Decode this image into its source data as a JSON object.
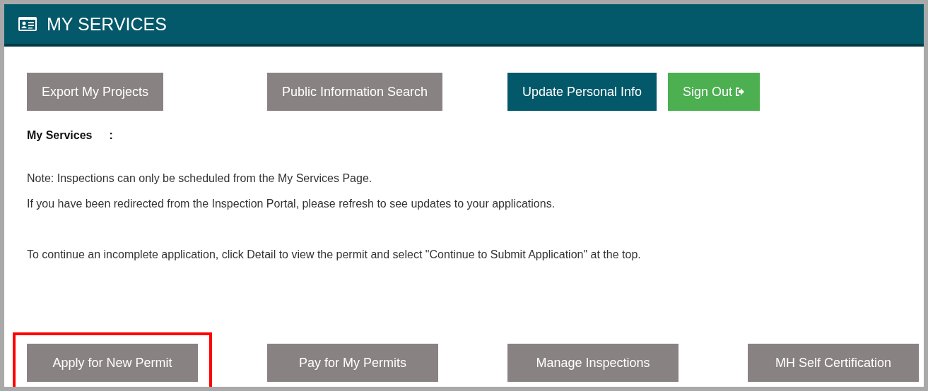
{
  "header": {
    "title": "MY SERVICES"
  },
  "top_buttons": [
    {
      "label": "Export My Projects",
      "kind": "secondary"
    },
    {
      "label": "Public Information Search",
      "kind": "secondary"
    },
    {
      "label": "Update Personal Info",
      "kind": "primary"
    },
    {
      "label": "Sign Out",
      "kind": "success"
    }
  ],
  "section_label": "My Services",
  "section_colon": ":",
  "notes": [
    "Note: Inspections can only be scheduled from the My Services Page.",
    "If you have been redirected from the Inspection Portal, please refresh to see updates to your applications."
  ],
  "instruction": "To continue an incomplete application, click Detail to view the permit and select \"Continue to Submit Application\" at the top.",
  "bottom_buttons": [
    {
      "label": "Apply for New Permit",
      "highlighted": true
    },
    {
      "label": "Pay for My Permits",
      "highlighted": false
    },
    {
      "label": "Manage Inspections",
      "highlighted": false
    },
    {
      "label": "MH Self Certification",
      "highlighted": false
    }
  ]
}
